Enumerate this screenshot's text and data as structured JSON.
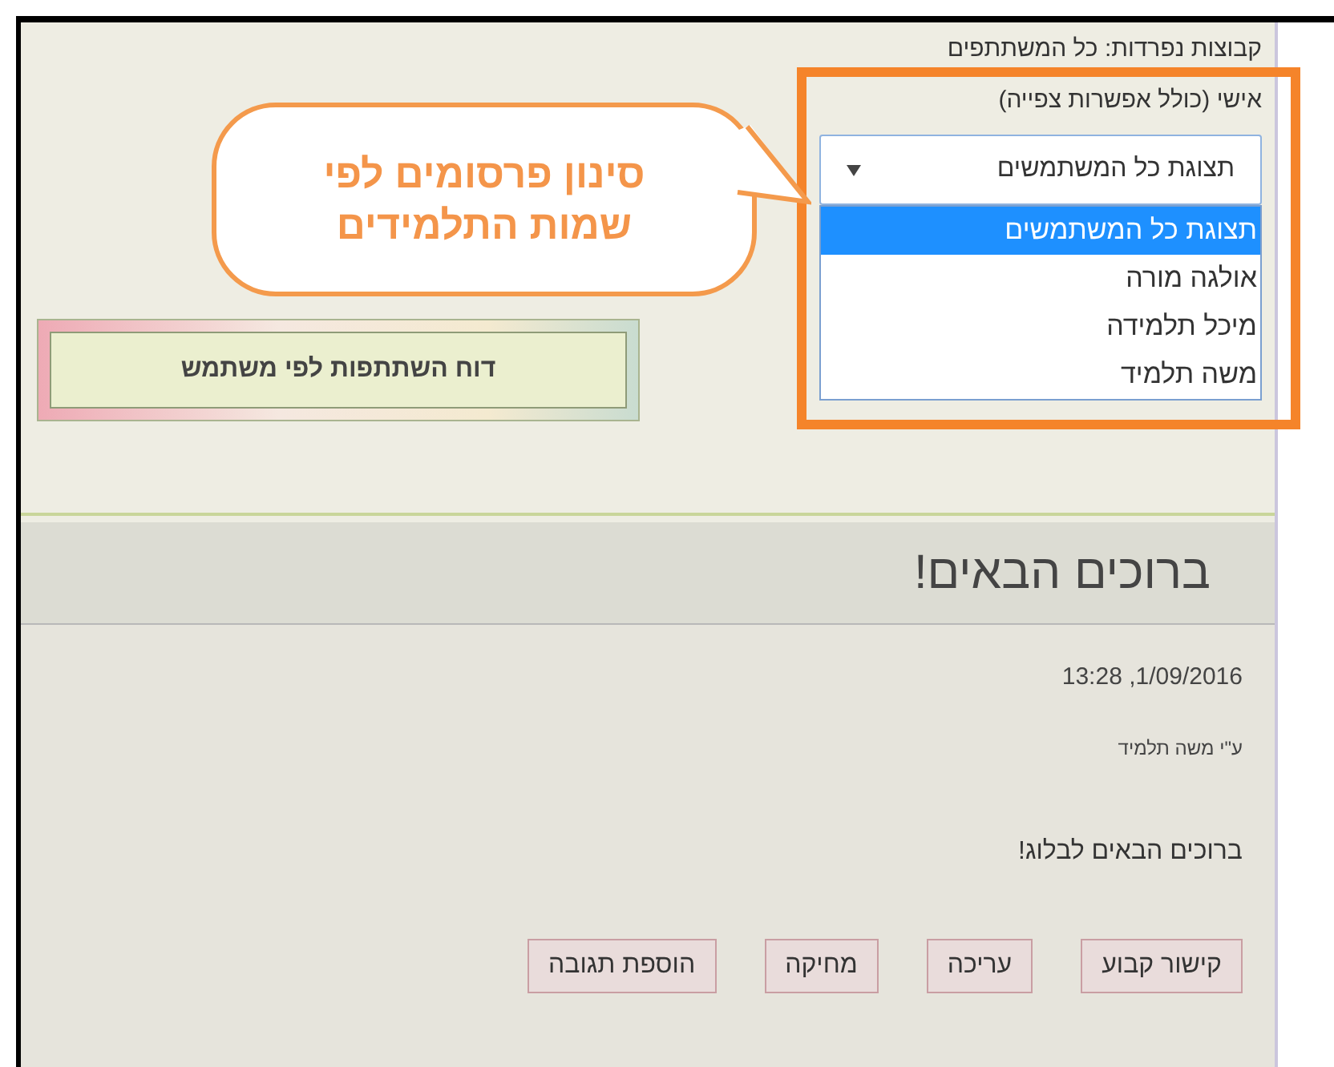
{
  "group_mode": "קבוצות נפרדות: כל המשתתפים",
  "filter": {
    "label": "אישי (כולל אפשרות צפייה)",
    "value": "תצוגת כל המשתמשים",
    "expanded": true,
    "options": [
      {
        "label": "תצוגת כל המשתמשים",
        "selected": true
      },
      {
        "label": "אולגה מורה",
        "selected": false
      },
      {
        "label": "מיכל תלמידה",
        "selected": false
      },
      {
        "label": "משה תלמיד",
        "selected": false
      }
    ]
  },
  "callout": {
    "text": "סינון פרסומים לפי שמות התלמידים"
  },
  "report_button": "דוח השתתפות לפי משתמש",
  "post": {
    "title": "ברוכים הבאים!",
    "date": "1/09/2016, 13:28",
    "author": "ע\"י משה תלמיד",
    "body": "ברוכים הבאים לבלוג!",
    "actions": [
      "קישור קבוע",
      "עריכה",
      "מחיקה",
      "הוספת תגובה"
    ]
  }
}
